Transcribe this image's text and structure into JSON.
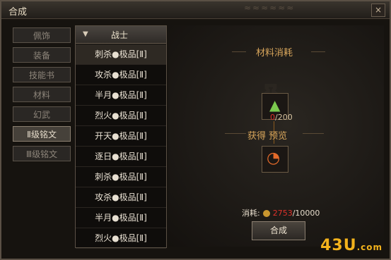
{
  "window": {
    "title": "合成"
  },
  "nav": {
    "items": [
      "佩饰",
      "装备",
      "技能书",
      "材料",
      "幻武",
      "Ⅱ级铭文",
      "Ⅲ级铭文"
    ],
    "active": 5
  },
  "list": {
    "header": "战士",
    "items": [
      "刺杀●极品[Ⅱ]",
      "攻杀●极品[Ⅱ]",
      "半月●极品[Ⅱ]",
      "烈火●极品[Ⅱ]",
      "开天●极品[Ⅱ]",
      "逐日●极品[Ⅱ]",
      "刺杀●极品[Ⅱ]",
      "攻杀●极品[Ⅱ]",
      "半月●极品[Ⅱ]",
      "烈火●极品[Ⅱ]"
    ],
    "selected": 0
  },
  "recipe": {
    "materials_header": "材料消耗",
    "material_have": "0",
    "material_need": "/200",
    "result_header": "获得 预览"
  },
  "cost": {
    "label": "消耗:",
    "current": "2753",
    "required": "/10000"
  },
  "actions": {
    "craft_label": "合成"
  },
  "watermark": {
    "text": "43U",
    "suffix": ".com"
  }
}
